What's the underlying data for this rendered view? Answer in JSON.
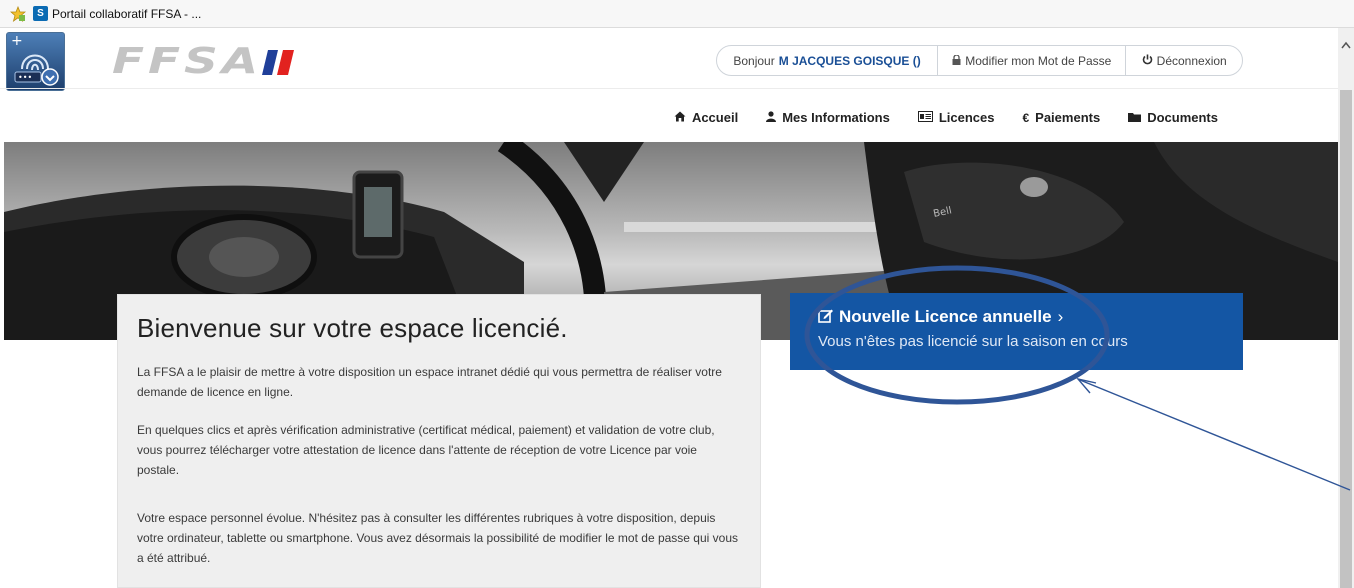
{
  "browser": {
    "favorite_link": "Portail collaboratif FFSA - ..."
  },
  "header": {
    "logo_text": "FFSA",
    "greeting_prefix": "Bonjour",
    "user_name": "M JACQUES GOISQUE ()",
    "change_password": "Modifier mon Mot de Passe",
    "logout": "Déconnexion"
  },
  "nav": {
    "items": [
      {
        "label": "Accueil",
        "icon": "home-icon"
      },
      {
        "label": "Mes Informations",
        "icon": "user-icon"
      },
      {
        "label": "Licences",
        "icon": "id-card-icon"
      },
      {
        "label": "Paiements",
        "icon": "euro-icon"
      },
      {
        "label": "Documents",
        "icon": "folder-icon"
      }
    ]
  },
  "welcome": {
    "title": "Bienvenue sur votre espace licencié.",
    "paragraphs": [
      "La FFSA a le plaisir de mettre à votre disposition un espace intranet dédié qui vous permettra de réaliser votre demande de licence en ligne.",
      "En quelques clics et après vérification administrative (certificat médical, paiement) et validation de votre club, vous pourrez télécharger votre attestation de licence dans l'attente de réception de votre Licence par voie postale.",
      "Votre espace personnel évolue. N'hésitez pas à consulter les différentes rubriques à votre disposition, depuis votre ordinateur, tablette ou smartphone. Vous avez désormais la possibilité de modifier le mot de passe qui vous a été attribué."
    ]
  },
  "cta": {
    "title": "Nouvelle Licence annuelle",
    "chevron": "›",
    "subtitle": "Vous n'êtes pas licencié sur la saison en cours"
  },
  "colors": {
    "brand_blue": "#1456a4",
    "annotation": "#2f5597",
    "flag_blue": "#1f3f99",
    "flag_red": "#e2221f"
  }
}
